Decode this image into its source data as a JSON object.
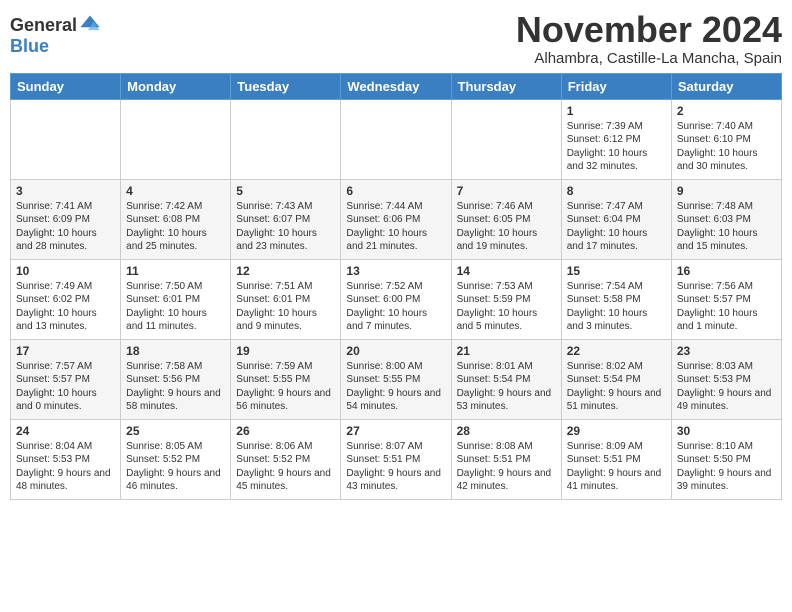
{
  "header": {
    "logo_general": "General",
    "logo_blue": "Blue",
    "month": "November 2024",
    "location": "Alhambra, Castille-La Mancha, Spain"
  },
  "weekdays": [
    "Sunday",
    "Monday",
    "Tuesday",
    "Wednesday",
    "Thursday",
    "Friday",
    "Saturday"
  ],
  "weeks": [
    [
      {
        "day": "",
        "info": ""
      },
      {
        "day": "",
        "info": ""
      },
      {
        "day": "",
        "info": ""
      },
      {
        "day": "",
        "info": ""
      },
      {
        "day": "",
        "info": ""
      },
      {
        "day": "1",
        "info": "Sunrise: 7:39 AM\nSunset: 6:12 PM\nDaylight: 10 hours and 32 minutes."
      },
      {
        "day": "2",
        "info": "Sunrise: 7:40 AM\nSunset: 6:10 PM\nDaylight: 10 hours and 30 minutes."
      }
    ],
    [
      {
        "day": "3",
        "info": "Sunrise: 7:41 AM\nSunset: 6:09 PM\nDaylight: 10 hours and 28 minutes."
      },
      {
        "day": "4",
        "info": "Sunrise: 7:42 AM\nSunset: 6:08 PM\nDaylight: 10 hours and 25 minutes."
      },
      {
        "day": "5",
        "info": "Sunrise: 7:43 AM\nSunset: 6:07 PM\nDaylight: 10 hours and 23 minutes."
      },
      {
        "day": "6",
        "info": "Sunrise: 7:44 AM\nSunset: 6:06 PM\nDaylight: 10 hours and 21 minutes."
      },
      {
        "day": "7",
        "info": "Sunrise: 7:46 AM\nSunset: 6:05 PM\nDaylight: 10 hours and 19 minutes."
      },
      {
        "day": "8",
        "info": "Sunrise: 7:47 AM\nSunset: 6:04 PM\nDaylight: 10 hours and 17 minutes."
      },
      {
        "day": "9",
        "info": "Sunrise: 7:48 AM\nSunset: 6:03 PM\nDaylight: 10 hours and 15 minutes."
      }
    ],
    [
      {
        "day": "10",
        "info": "Sunrise: 7:49 AM\nSunset: 6:02 PM\nDaylight: 10 hours and 13 minutes."
      },
      {
        "day": "11",
        "info": "Sunrise: 7:50 AM\nSunset: 6:01 PM\nDaylight: 10 hours and 11 minutes."
      },
      {
        "day": "12",
        "info": "Sunrise: 7:51 AM\nSunset: 6:01 PM\nDaylight: 10 hours and 9 minutes."
      },
      {
        "day": "13",
        "info": "Sunrise: 7:52 AM\nSunset: 6:00 PM\nDaylight: 10 hours and 7 minutes."
      },
      {
        "day": "14",
        "info": "Sunrise: 7:53 AM\nSunset: 5:59 PM\nDaylight: 10 hours and 5 minutes."
      },
      {
        "day": "15",
        "info": "Sunrise: 7:54 AM\nSunset: 5:58 PM\nDaylight: 10 hours and 3 minutes."
      },
      {
        "day": "16",
        "info": "Sunrise: 7:56 AM\nSunset: 5:57 PM\nDaylight: 10 hours and 1 minute."
      }
    ],
    [
      {
        "day": "17",
        "info": "Sunrise: 7:57 AM\nSunset: 5:57 PM\nDaylight: 10 hours and 0 minutes."
      },
      {
        "day": "18",
        "info": "Sunrise: 7:58 AM\nSunset: 5:56 PM\nDaylight: 9 hours and 58 minutes."
      },
      {
        "day": "19",
        "info": "Sunrise: 7:59 AM\nSunset: 5:55 PM\nDaylight: 9 hours and 56 minutes."
      },
      {
        "day": "20",
        "info": "Sunrise: 8:00 AM\nSunset: 5:55 PM\nDaylight: 9 hours and 54 minutes."
      },
      {
        "day": "21",
        "info": "Sunrise: 8:01 AM\nSunset: 5:54 PM\nDaylight: 9 hours and 53 minutes."
      },
      {
        "day": "22",
        "info": "Sunrise: 8:02 AM\nSunset: 5:54 PM\nDaylight: 9 hours and 51 minutes."
      },
      {
        "day": "23",
        "info": "Sunrise: 8:03 AM\nSunset: 5:53 PM\nDaylight: 9 hours and 49 minutes."
      }
    ],
    [
      {
        "day": "24",
        "info": "Sunrise: 8:04 AM\nSunset: 5:53 PM\nDaylight: 9 hours and 48 minutes."
      },
      {
        "day": "25",
        "info": "Sunrise: 8:05 AM\nSunset: 5:52 PM\nDaylight: 9 hours and 46 minutes."
      },
      {
        "day": "26",
        "info": "Sunrise: 8:06 AM\nSunset: 5:52 PM\nDaylight: 9 hours and 45 minutes."
      },
      {
        "day": "27",
        "info": "Sunrise: 8:07 AM\nSunset: 5:51 PM\nDaylight: 9 hours and 43 minutes."
      },
      {
        "day": "28",
        "info": "Sunrise: 8:08 AM\nSunset: 5:51 PM\nDaylight: 9 hours and 42 minutes."
      },
      {
        "day": "29",
        "info": "Sunrise: 8:09 AM\nSunset: 5:51 PM\nDaylight: 9 hours and 41 minutes."
      },
      {
        "day": "30",
        "info": "Sunrise: 8:10 AM\nSunset: 5:50 PM\nDaylight: 9 hours and 39 minutes."
      }
    ]
  ]
}
